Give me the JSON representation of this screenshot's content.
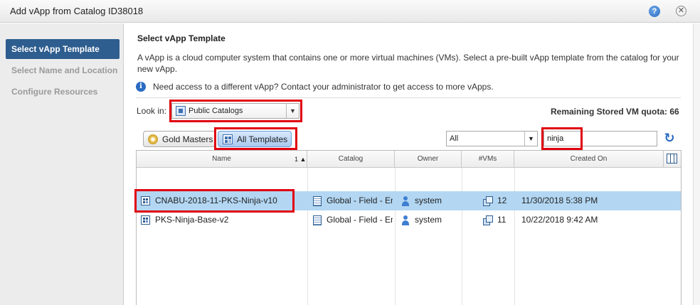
{
  "window": {
    "title": "Add vApp from Catalog ID38018"
  },
  "steps": [
    {
      "label": "Select vApp Template",
      "active": true
    },
    {
      "label": "Select Name and Location",
      "active": false
    },
    {
      "label": "Configure Resources",
      "active": false
    }
  ],
  "main": {
    "heading": "Select vApp Template",
    "description": "A vApp is a cloud computer system that contains one or more virtual machines (VMs). Select a pre-built vApp template from the catalog for your new vApp.",
    "info": "Need access to a different vApp? Contact your administrator to get access to more vApps.",
    "look_in_label": "Look in:",
    "look_in_value": "Public Catalogs",
    "quota": "Remaining Stored VM quota: 66",
    "filter_buttons": {
      "gold": "Gold Masters",
      "all": "All Templates"
    },
    "filter_select": "All",
    "search_value": "ninja"
  },
  "grid": {
    "columns": [
      "Name",
      "Catalog",
      "Owner",
      "#VMs",
      "Created On"
    ],
    "sort_indicator": "1 ▲",
    "rows": [
      {
        "name": "CNABU-2018-11-PKS-Ninja-v10",
        "catalog": "Global - Field - Enablement",
        "owner": "system",
        "vms": "12",
        "created": "11/30/2018 5:38 PM",
        "selected": true
      },
      {
        "name": "PKS-Ninja-Base-v2",
        "catalog": "Global - Field - Enablement",
        "owner": "system",
        "vms": "11",
        "created": "10/22/2018 9:42 AM",
        "selected": false
      }
    ]
  },
  "colors": {
    "accent": "#2e5d8f",
    "selected_row": "#b3d7f3",
    "highlight_box": "#e0000f"
  }
}
